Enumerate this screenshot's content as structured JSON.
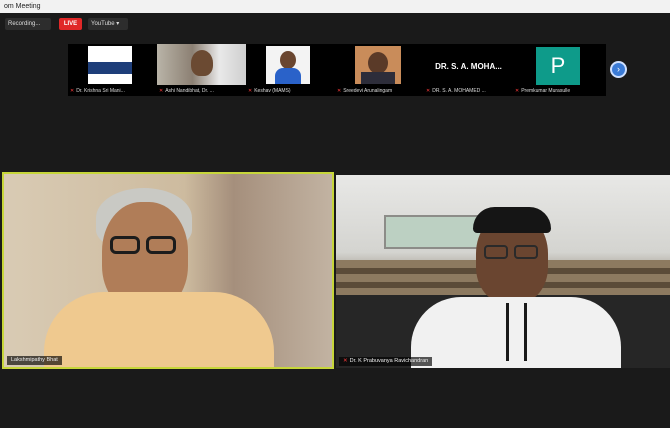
{
  "window": {
    "title": "om Meeting"
  },
  "toolbar": {
    "recording_label": "Recording...",
    "live_label": "LIVE",
    "youtube_label": "YouTube ▾"
  },
  "strip": {
    "participants": [
      {
        "name": "Dr. Krishna Sri Mani..."
      },
      {
        "name": "Ashi Nandibhat, Dr. ..."
      },
      {
        "name": "Keshav (MAMS)"
      },
      {
        "name": "Sreedevi Arunalingam"
      },
      {
        "name": "DR. S. A. MOHAMED ...",
        "display_text": "DR. S. A. MOHA..."
      },
      {
        "name": "Premkumar Murasulle",
        "logo_letter": "P"
      }
    ]
  },
  "main": {
    "speakers": [
      {
        "name": "Lakshmipathy Bhat"
      },
      {
        "name": "Dr. K Prabuvanya Ravichandran"
      }
    ]
  },
  "colors": {
    "active_speaker": "#c7d63a",
    "live": "#e02828",
    "mute": "#ff3b3b",
    "next_button": "#3b7bd6",
    "tile_logo": "#0e9b8a"
  }
}
